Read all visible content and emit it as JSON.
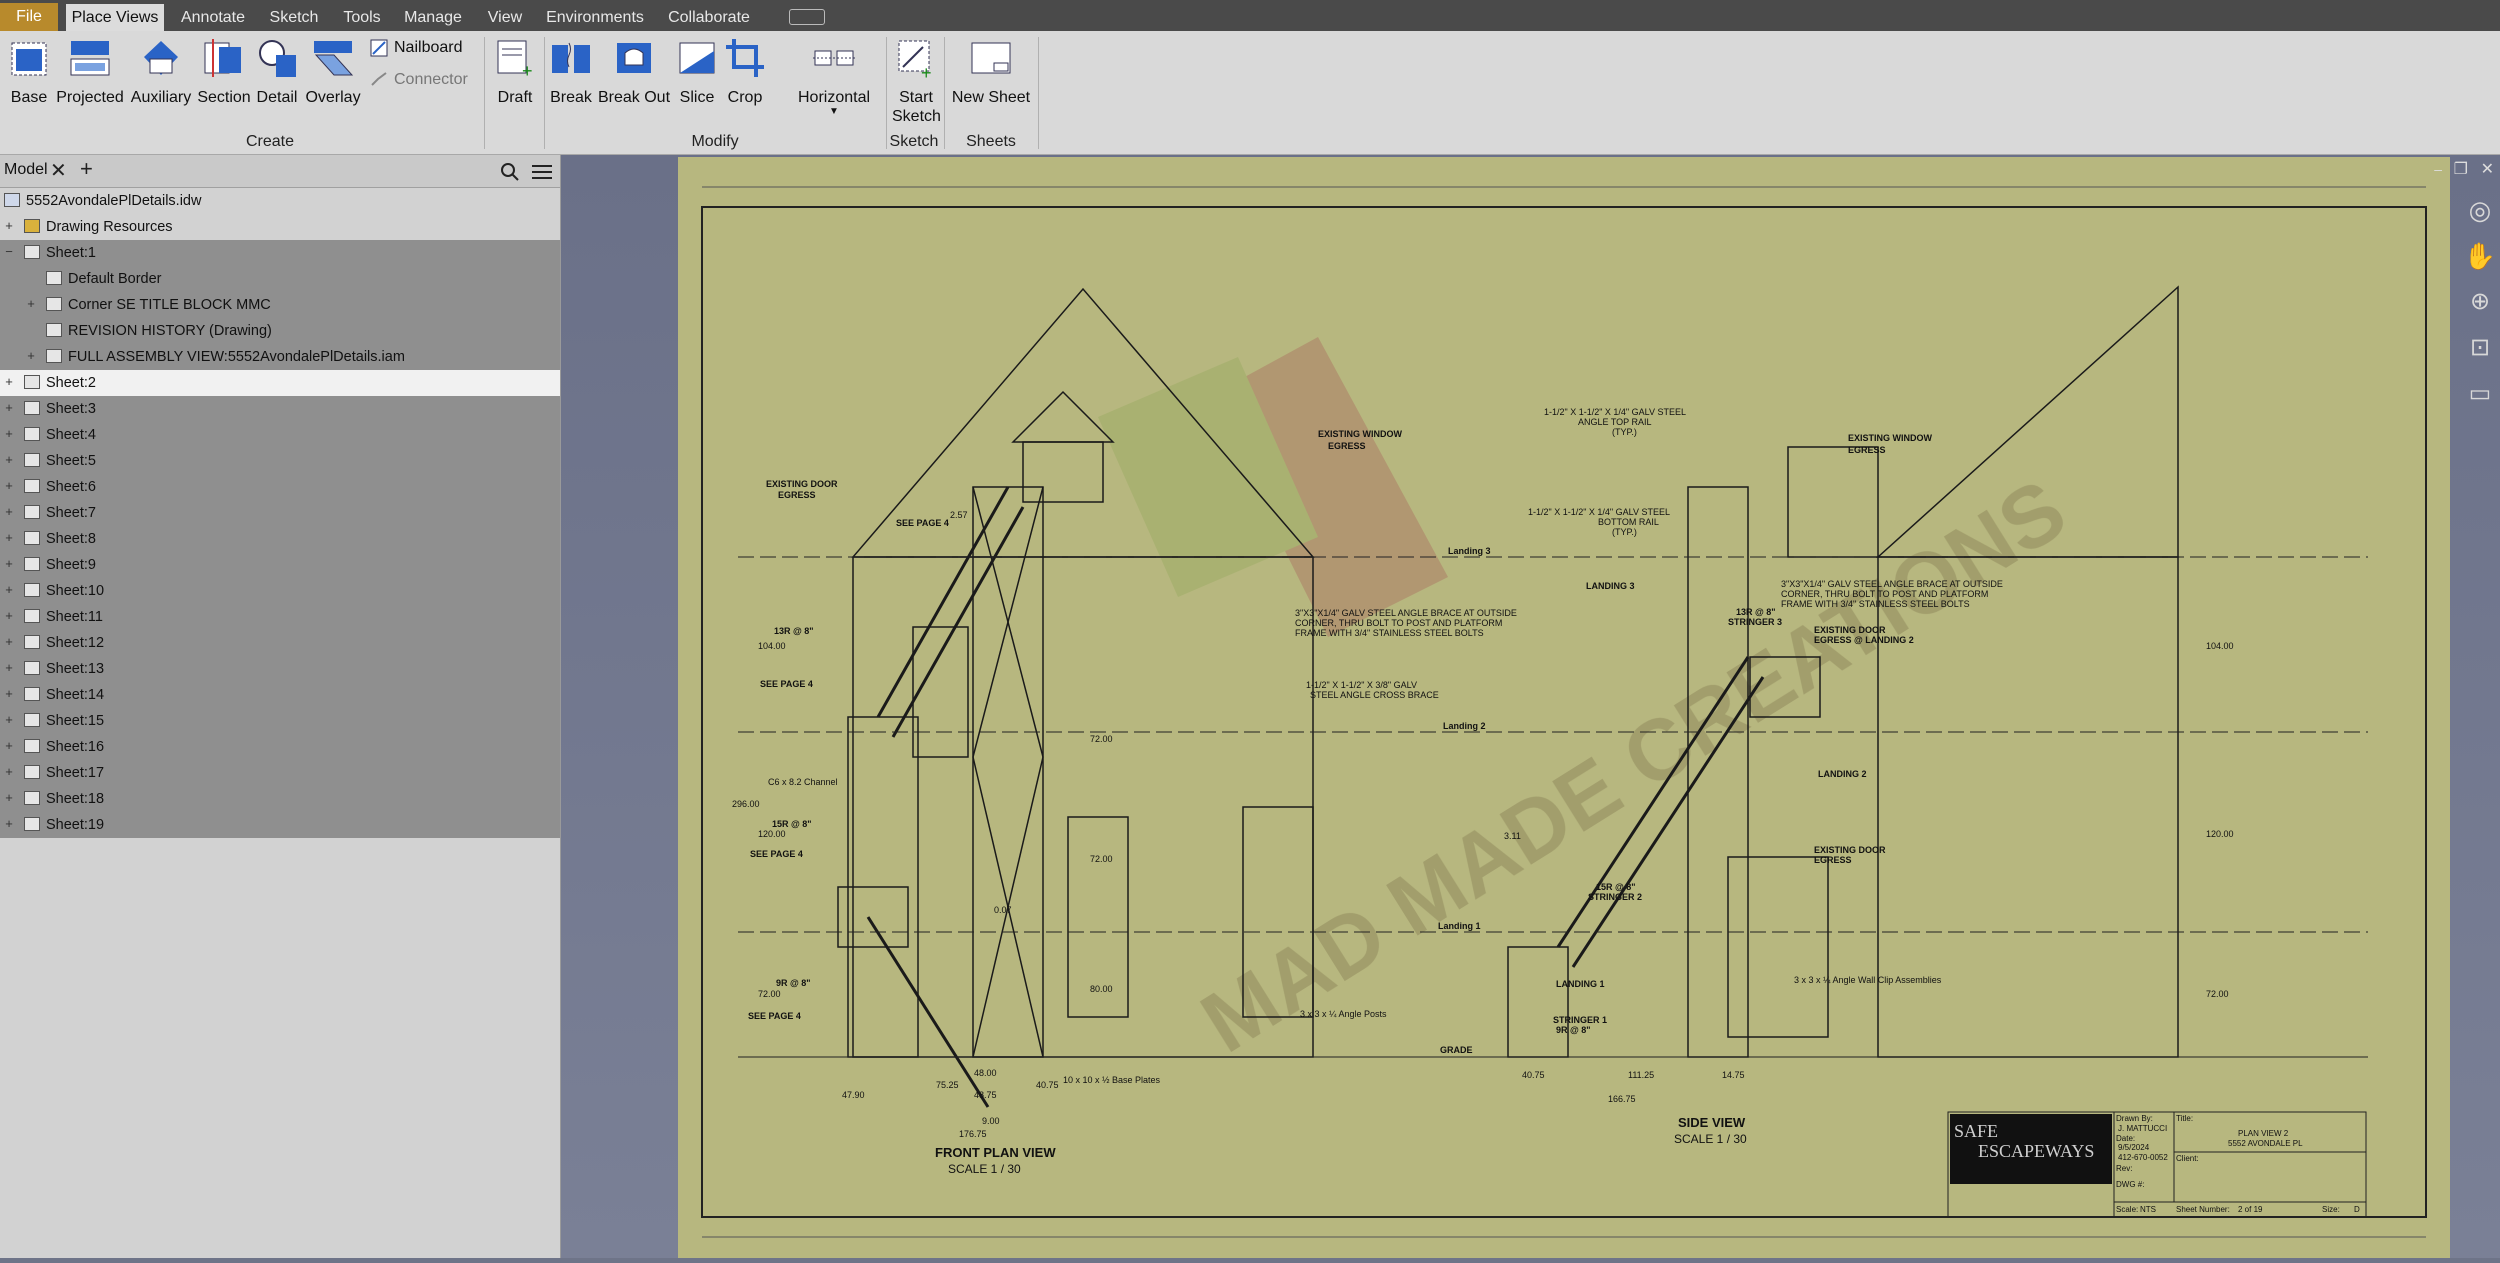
{
  "tabs": [
    "File",
    "Place Views",
    "Annotate",
    "Sketch",
    "Tools",
    "Manage",
    "View",
    "Environments",
    "Collaborate"
  ],
  "ribbon": {
    "create": {
      "base": "Base",
      "projected": "Projected",
      "auxiliary": "Auxiliary",
      "section": "Section",
      "detail": "Detail",
      "overlay": "Overlay",
      "nailboard": "Nailboard",
      "connector": "Connector",
      "draft": "Draft",
      "panel": "Create"
    },
    "modify": {
      "break": "Break",
      "breakout": "Break Out",
      "slice": "Slice",
      "crop": "Crop",
      "horizontal": "Horizontal",
      "panel": "Modify"
    },
    "sketch": {
      "start_line1": "Start",
      "start_line2": "Sketch",
      "panel": "Sketch"
    },
    "sheets": {
      "new_sheet": "New Sheet",
      "panel": "Sheets"
    }
  },
  "browser": {
    "tab": "Model",
    "file": "5552AvondalePlDetails.idw",
    "drawing_resources": "Drawing Resources",
    "sheet1": "Sheet:1",
    "sheet1_children": [
      "Default Border",
      "Corner SE TITLE BLOCK MMC",
      "REVISION HISTORY (Drawing)",
      "FULL ASSEMBLY VIEW:5552AvondalePlDetails.iam"
    ],
    "sheets": [
      "Sheet:2",
      "Sheet:3",
      "Sheet:4",
      "Sheet:5",
      "Sheet:6",
      "Sheet:7",
      "Sheet:8",
      "Sheet:9",
      "Sheet:10",
      "Sheet:11",
      "Sheet:12",
      "Sheet:13",
      "Sheet:14",
      "Sheet:15",
      "Sheet:16",
      "Sheet:17",
      "Sheet:18",
      "Sheet:19"
    ]
  },
  "drawing": {
    "front_title": "FRONT PLAN VIEW",
    "front_scale": "SCALE 1 / 30",
    "side_title": "SIDE VIEW",
    "side_scale": "SCALE 1 / 30",
    "notes": {
      "existing_door": "EXISTING DOOR",
      "egress": "EGRESS",
      "existing_window": "EXISTING WINDOW",
      "landing3": "Landing 3",
      "landing2": "Landing 2",
      "landing1": "Landing 1",
      "grade": "GRADE",
      "see4a": "SEE PAGE 4",
      "r13": "13R @ 8\"",
      "r15": "15R @ 8\"",
      "r9": "9R @ 8\"",
      "brace": "3\"X3\"X1/4\" GALV STEEL ANGLE BRACE AT OUTSIDE",
      "brace2": "CORNER, THRU BOLT TO POST AND PLATFORM",
      "brace3": "FRAME WITH 3/4\" STAINLESS STEEL BOLTS",
      "cross": "1-1/2\" X 1-1/2\" X 3/8\" GALV",
      "cross2": "STEEL ANGLE CROSS BRACE",
      "channel": "C6 x 8.2 Channel",
      "baseplates": "10 x 10 x ½ Base Plates",
      "angleposts": "3 x 3 x ¼ Angle Posts",
      "toprail": "1-1/2\" X 1-1/2\" X 1/4\" GALV STEEL",
      "toprail2": "ANGLE TOP RAIL",
      "typ": "(TYP.)",
      "botrail": "1-1/2\" X 1-1/2\" X 1/4\" GALV STEEL",
      "botrail2": "BOTTOM RAIL",
      "stringer3": "13R @ 8\"",
      "stringer3b": "STRINGER 3",
      "stringer2": "15R @ 8\"",
      "stringer2b": "STRINGER 2",
      "stringer1": "STRINGER 1",
      "stringer1b": "9R @ 8\"",
      "egress_l2": "EXISTING DOOR",
      "egress_l2b": "EGRESS @ LANDING 2",
      "clip": "3 x 3 x ¼ Angle Wall Clip Assemblies",
      "landing3s": "LANDING 3",
      "landing2s": "LANDING 2",
      "landing1s": "LANDING 1"
    },
    "dims": {
      "d296": "296.00",
      "d104": "104.00",
      "d120": "120.00",
      "d72": "72.00",
      "d4800": "48.00",
      "d4875": "48.75",
      "d4790": "47.90",
      "d900": "9.00",
      "d7525": "75.25",
      "d4075": "40.75",
      "d17675": "176.75",
      "d257": "2.57",
      "d007": "0.07",
      "d8000": "80.00",
      "d311": "3.11",
      "d11125": "111.25",
      "d1475": "14.75",
      "d16675": "166.75"
    },
    "titleblock": {
      "brand1": "SAFE",
      "brand2": "ESCAPEWAYS",
      "title_label": "Title:",
      "title1": "PLAN VIEW 2",
      "title2": "5552 AVONDALE PL",
      "drawn": "Drawn By:",
      "drawn_by": "J. MATTUCCI",
      "date": "Date:",
      "date_val": "9/5/2024",
      "phone": "412-670-0052",
      "client": "Client:",
      "dwg": "DWG #:",
      "rev": "Rev:",
      "scale": "Scale:",
      "scale_val": "NTS",
      "sheetnum": "Sheet Number:",
      "sheetnum_val": "2 of 19",
      "size": "Size:",
      "size_val": "D"
    },
    "watermark": "MAD MADE CREATIONS"
  }
}
